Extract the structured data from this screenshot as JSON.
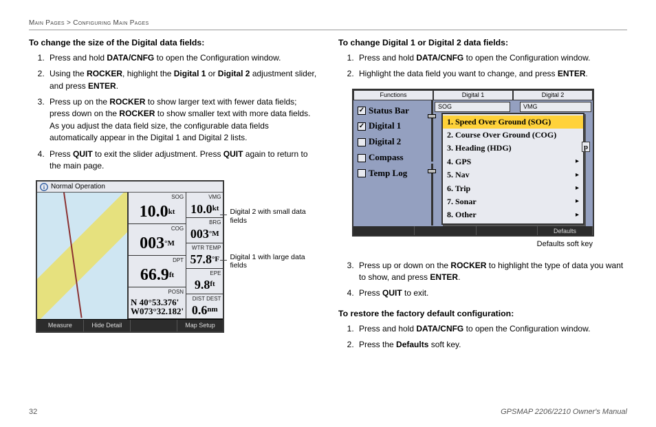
{
  "breadcrumb": "Main Pages > Configuring Main Pages",
  "left": {
    "heading": "To change the size of the Digital data fields:",
    "steps": [
      "Press and hold <b>DATA/CNFG</b> to open the Configuration window.",
      "Using the <b>ROCKER</b>, highlight the <b>Digital 1</b> or <b>Digital 2</b> adjustment slider, and press <b>ENTER</b>.",
      "Press up on the <b>ROCKER</b> to show larger text with fewer data fields; press down on the <b>ROCKER</b> to show smaller text with more data fields. As you adjust the data field size, the configurable data fields automatically appear in the Digital 1 and Digital 2 lists.",
      "Press <b>QUIT</b> to exit the slider adjustment. Press <b>QUIT</b> again to return to the main page."
    ],
    "figure": {
      "mode": "Normal Operation",
      "c1": [
        {
          "label": "SOG",
          "val": "10.0",
          "unit": "kt"
        },
        {
          "label": "COG",
          "val": "003",
          "unit": "°M"
        },
        {
          "label": "DPT",
          "val": "66.9",
          "unit": "ft"
        },
        {
          "label": "POSN",
          "posn1": "N  40°53.376'",
          "posn2": "W073°32.182'"
        }
      ],
      "c2": [
        {
          "label": "VMG",
          "val": "10.0",
          "unit": "kt"
        },
        {
          "label": "BRG",
          "val": "003",
          "unit": "°M"
        },
        {
          "label": "WTR TEMP",
          "val": "57.8",
          "unit": "°F"
        },
        {
          "label": "EPE",
          "val": "9.8",
          "unit": "ft"
        },
        {
          "label": "DIST DEST",
          "val": "0.6",
          "unit": "nm"
        }
      ],
      "footer": [
        "Measure",
        "Hide Detail",
        "",
        "Map Setup"
      ],
      "callouts": [
        "Digital 2 with small data fields",
        "Digital 1 with large data fields"
      ]
    }
  },
  "right": {
    "heading": "To change Digital 1 or Digital 2 data fields:",
    "steps12": [
      "Press and hold <b>DATA/CNFG</b> to open the Configuration window.",
      "Highlight the data field you want to change, and press <b>ENTER</b>."
    ],
    "steps34": [
      "Press up or down on the <b>ROCKER</b> to highlight the type of data you want to show, and press <b>ENTER</b>.",
      "Press <b>QUIT</b> to exit."
    ],
    "heading2": "To restore the factory default configuration:",
    "restore": [
      "Press and hold <b>DATA/CNFG</b> to open the Configuration window.",
      "Press the <b>Defaults</b> soft key."
    ],
    "cfg": {
      "tabs": [
        "Functions",
        "Digital 1",
        "Digital 2"
      ],
      "left_items": [
        {
          "label": "Status Bar",
          "checked": true
        },
        {
          "label": "Digital 1",
          "checked": true
        },
        {
          "label": "Digital 2",
          "checked": false
        },
        {
          "label": "Compass",
          "checked": false
        },
        {
          "label": "Temp Log",
          "checked": false
        }
      ],
      "sog": "SOG",
      "vmg": "VMG",
      "p_behind": "p",
      "menu": [
        {
          "label": "1. Speed Over Ground (SOG)",
          "sel": true,
          "arrow": false
        },
        {
          "label": "2. Course Over Ground (COG)",
          "arrow": false
        },
        {
          "label": "3. Heading (HDG)",
          "arrow": false
        },
        {
          "label": "4. GPS",
          "arrow": true
        },
        {
          "label": "5. Nav",
          "arrow": true
        },
        {
          "label": "6. Trip",
          "arrow": true
        },
        {
          "label": "7. Sonar",
          "arrow": true
        },
        {
          "label": "8. Other",
          "arrow": true
        }
      ],
      "footer_label": "Defaults",
      "caption": "Defaults soft key"
    }
  },
  "footer": {
    "page": "32",
    "title": "GPSMAP 2206/2210 Owner's Manual"
  }
}
